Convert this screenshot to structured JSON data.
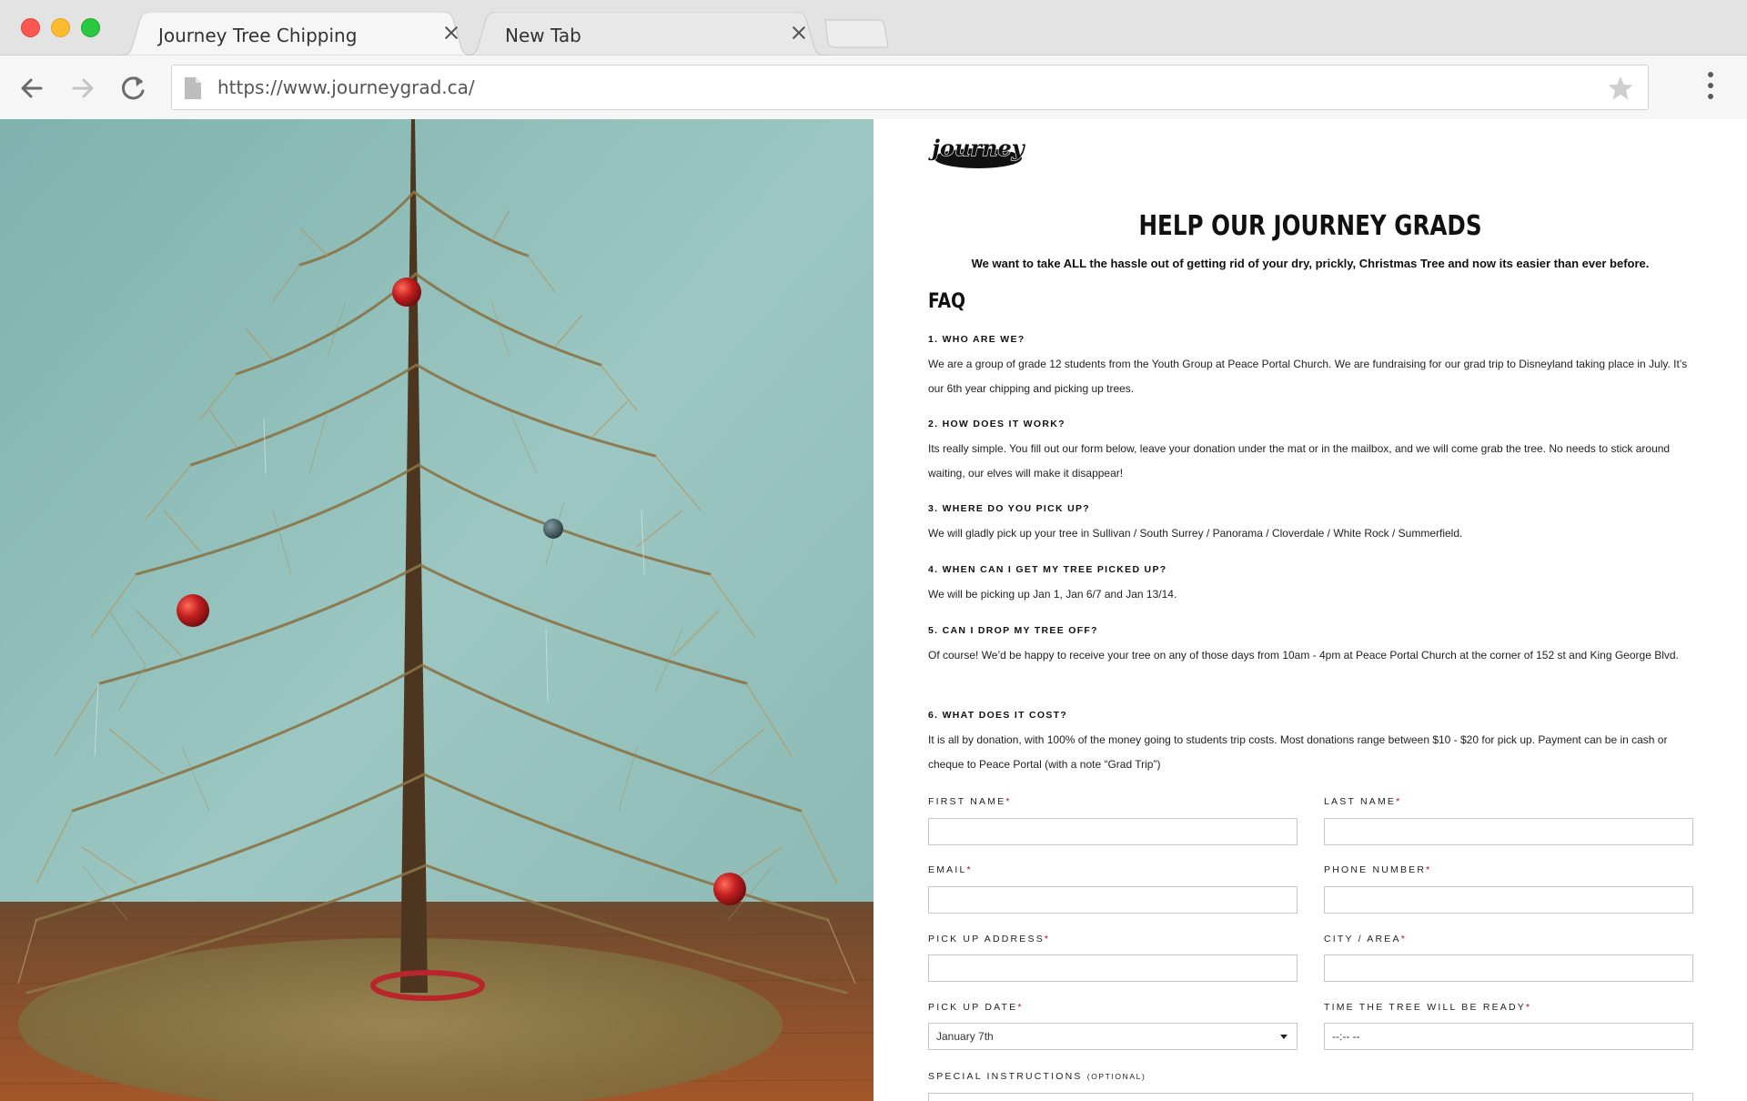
{
  "browser": {
    "tabs": [
      {
        "title": "Journey Tree Chipping",
        "active": true
      },
      {
        "title": "New Tab",
        "active": false
      }
    ],
    "url": "https://www.journeygrad.ca/"
  },
  "colors": {
    "required_marker": "#d0021b",
    "wall": "#8fbcb8",
    "floor": "#8a4e2a"
  },
  "logo_text": "journey",
  "page": {
    "title": "HELP OUR JOURNEY GRADS",
    "intro": "We want to take ALL the hassle out of getting rid of your dry, prickly, Christmas Tree and now its easier than ever before.",
    "faq_heading": "FAQ",
    "faq": [
      {
        "question": "1. WHO ARE WE?",
        "answer": "We are a group of grade 12 students from the Youth Group at Peace Portal Church. We are fundraising for our grad trip to Disneyland taking place in July. It’s our 6th year chipping and picking up trees."
      },
      {
        "question": "2. HOW DOES IT WORK?",
        "answer": "Its really simple. You fill out our form below, leave your donation under the mat or in the mailbox, and we will come grab the tree. No needs to stick around waiting, our elves will make it disappear!"
      },
      {
        "question": "3. WHERE DO YOU PICK UP?",
        "answer": "We will gladly pick up your tree in Sullivan / South Surrey / Panorama / Cloverdale / White Rock / Summerfield."
      },
      {
        "question": "4. WHEN CAN I GET MY TREE PICKED UP?",
        "answer": "We will be picking up Jan 1, Jan 6/7 and Jan 13/14."
      },
      {
        "question": "5. CAN I DROP MY TREE OFF?",
        "answer": "Of course! We’d be happy to receive your tree on any of those days from 10am - 4pm at Peace Portal Church at the corner of 152 st and King George Blvd."
      },
      {
        "question": "6. WHAT DOES IT COST?",
        "answer": "It is all by donation, with 100% of the money going to students trip costs. Most donations range between $10 - $20 for pick up. Payment can be in cash or cheque to Peace Portal (with a note “Grad Trip”)"
      }
    ]
  },
  "form": {
    "required_mark": "*",
    "first_name": {
      "label": "FIRST NAME",
      "value": ""
    },
    "last_name": {
      "label": "LAST NAME",
      "value": ""
    },
    "email": {
      "label": "EMAIL",
      "value": ""
    },
    "phone": {
      "label": "PHONE NUMBER",
      "value": ""
    },
    "address": {
      "label": "PICK UP ADDRESS",
      "value": ""
    },
    "city": {
      "label": "CITY / AREA",
      "value": ""
    },
    "pickup_date": {
      "label": "PICK UP DATE",
      "value": "January 7th"
    },
    "ready_time": {
      "label": "TIME THE TREE WILL BE READY",
      "value": "--:-- --"
    },
    "special": {
      "label": "SPECIAL INSTRUCTIONS",
      "optional": "(OPTIONAL)"
    }
  }
}
